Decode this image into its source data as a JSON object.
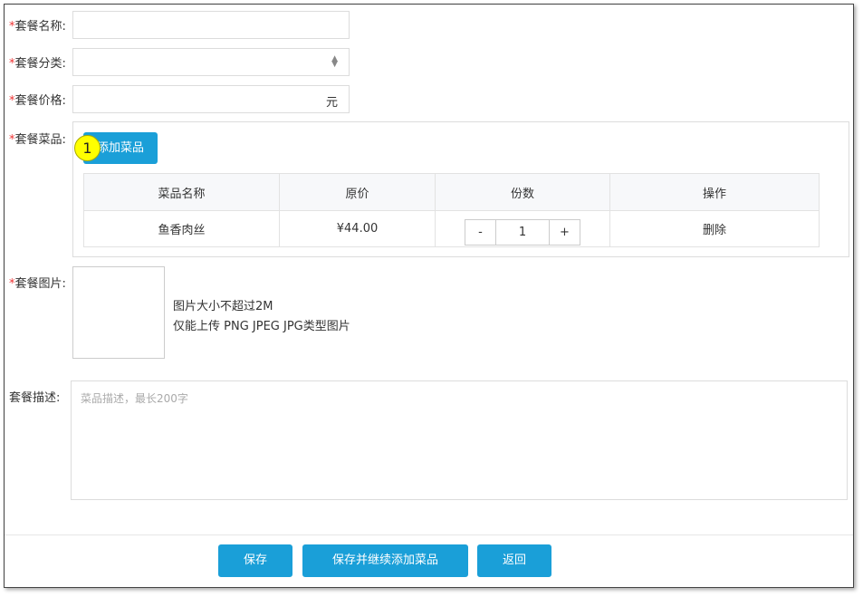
{
  "form": {
    "name_label": "套餐名称:",
    "category_label": "套餐分类:",
    "price_label": "套餐价格:",
    "price_unit": "元",
    "dishes_label": "套餐菜品:",
    "image_label": "套餐图片:",
    "desc_label": "套餐描述:",
    "required_mark": "*",
    "add_dish_button": "添加菜品",
    "annotation_badge": "1",
    "image_hint_1": "图片大小不超过2M",
    "image_hint_2": "仅能上传 PNG JPEG JPG类型图片",
    "desc_placeholder": "菜品描述，最长200字"
  },
  "table": {
    "headers": [
      "菜品名称",
      "原价",
      "份数",
      "操作"
    ],
    "rows": [
      {
        "name": "鱼香肉丝",
        "price": "¥44.00",
        "qty": "1",
        "minus": "-",
        "plus": "+",
        "action": "删除"
      }
    ]
  },
  "footer": {
    "save": "保存",
    "save_continue": "保存并继续添加菜品",
    "back": "返回"
  },
  "colors": {
    "primary": "#1a9fd8",
    "required": "#e33"
  }
}
